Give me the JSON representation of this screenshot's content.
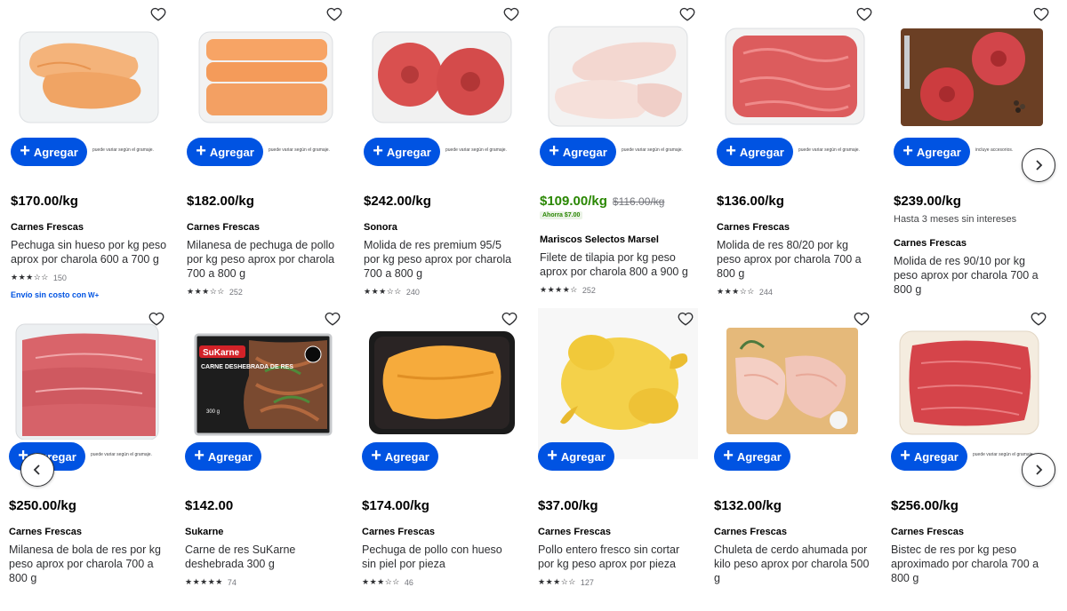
{
  "common": {
    "add_label": "Agregar",
    "weight_note": "puede variar según el gramaje."
  },
  "row1": [
    {
      "price": "$170.00/kg",
      "brand": "Carnes Frescas",
      "title": "Pechuga sin hueso por kg peso aprox por charola 600 a 700 g",
      "stars": "★★★☆☆",
      "count": "150",
      "shipping": "Envío sin costo con",
      "shipping_logo": "W+"
    },
    {
      "price": "$182.00/kg",
      "brand": "Carnes Frescas",
      "title": "Milanesa de pechuga de pollo por kg peso aprox por charola 700 a 800 g",
      "stars": "★★★☆☆",
      "count": "252"
    },
    {
      "price": "$242.00/kg",
      "brand": "Sonora",
      "title": "Molida de res premium 95/5 por kg peso aprox por charola 700 a 800 g",
      "stars": "★★★☆☆",
      "count": "240"
    },
    {
      "price": "$109.00/kg",
      "was_price": "$116.00/kg",
      "savings": "Ahorra $7.00",
      "brand": "Mariscos Selectos Marsel",
      "title": "Filete de tilapia por kg peso aprox por charola 800 a 900 g",
      "stars": "★★★★☆",
      "count": "252"
    },
    {
      "price": "$136.00/kg",
      "brand": "Carnes Frescas",
      "title": "Molida de res 80/20 por kg peso aprox por charola 700 a 800 g",
      "stars": "★★★☆☆",
      "count": "244"
    },
    {
      "price": "$239.00/kg",
      "installments": "Hasta 3 meses sin intereses",
      "brand": "Carnes Frescas",
      "title": "Molida de res 90/10 por kg peso aprox por charola 700 a 800 g",
      "note": "incluye accesorios."
    }
  ],
  "row2": [
    {
      "price": "$250.00/kg",
      "brand": "Carnes Frescas",
      "title": "Milanesa de bola de res por kg peso aprox por charola 700 a 800 g"
    },
    {
      "price": "$142.00",
      "brand": "Sukarne",
      "title": "Carne de res SuKarne deshebrada 300 g",
      "stars": "★★★★★",
      "count": "74",
      "pkg_logo": "SuKarne",
      "pkg_text": "CARNE DESHEBRADA DE RES",
      "pkg_weight": "300 g"
    },
    {
      "price": "$174.00/kg",
      "brand": "Carnes Frescas",
      "title": "Pechuga de pollo con hueso sin piel por pieza",
      "stars": "★★★☆☆",
      "count": "46"
    },
    {
      "price": "$37.00/kg",
      "brand": "Carnes Frescas",
      "title": "Pollo entero fresco sin cortar por kg peso aprox por pieza",
      "stars": "★★★☆☆",
      "count": "127"
    },
    {
      "price": "$132.00/kg",
      "brand": "Carnes Frescas",
      "title": "Chuleta de cerdo ahumada por kilo peso aprox por charola 500 g"
    },
    {
      "price": "$256.00/kg",
      "brand": "Carnes Frescas",
      "title": "Bistec de res por kg peso aproximado por charola 700 a 800 g"
    }
  ],
  "icons": {
    "favorite": "heart-outline-icon",
    "add": "plus-icon",
    "next": "chevron-right-icon",
    "prev": "chevron-left-icon"
  },
  "colors": {
    "primary": "#0053e2",
    "sale": "#2a8703",
    "text": "#2e2f32"
  }
}
